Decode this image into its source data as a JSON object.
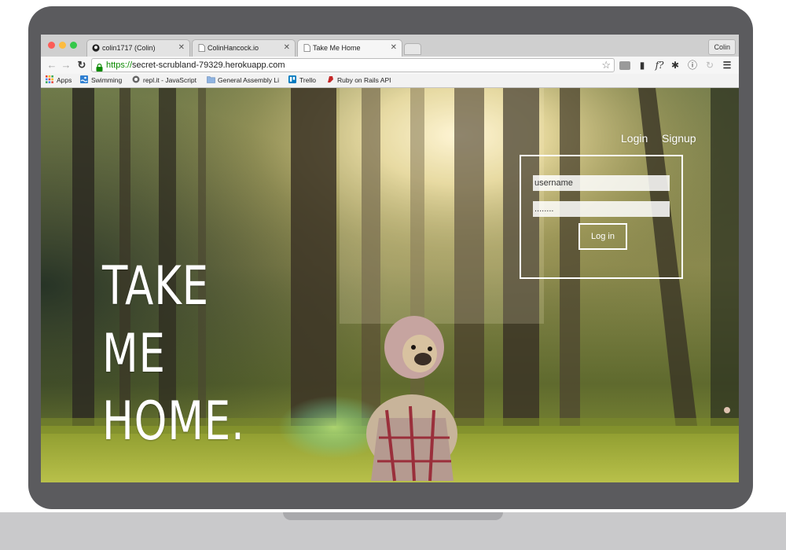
{
  "browser": {
    "tabs": [
      {
        "title": "colin1717 (Colin)",
        "icon": "github-icon",
        "active": false
      },
      {
        "title": "ColinHancock.io",
        "icon": "page-icon",
        "active": false
      },
      {
        "title": "Take Me Home",
        "icon": "page-icon",
        "active": true
      }
    ],
    "profile_name": "Colin",
    "url_scheme": "https://",
    "url_rest": "secret-scrubland-79329.herokuapp.com",
    "bookmarks": [
      {
        "label": "Apps",
        "icon": "apps-grid-icon"
      },
      {
        "label": "Swimming",
        "icon": "swimming-icon"
      },
      {
        "label": "repl.it - JavaScript",
        "icon": "replit-icon"
      },
      {
        "label": "General Assembly Li",
        "icon": "folder-icon"
      },
      {
        "label": "Trello",
        "icon": "trello-icon"
      },
      {
        "label": "Ruby on Rails API",
        "icon": "rails-icon"
      }
    ],
    "colors": {
      "url_scheme": "#0b8a00",
      "tab_active": "#f6f6f6"
    }
  },
  "page": {
    "hero": {
      "line1": "TAKE",
      "line2": "ME",
      "line3": "HOME."
    },
    "nav": {
      "login": "Login",
      "signup": "Signup"
    },
    "login_form": {
      "username_placeholder": "username",
      "password_value": "........",
      "button_label": "Log in"
    }
  }
}
